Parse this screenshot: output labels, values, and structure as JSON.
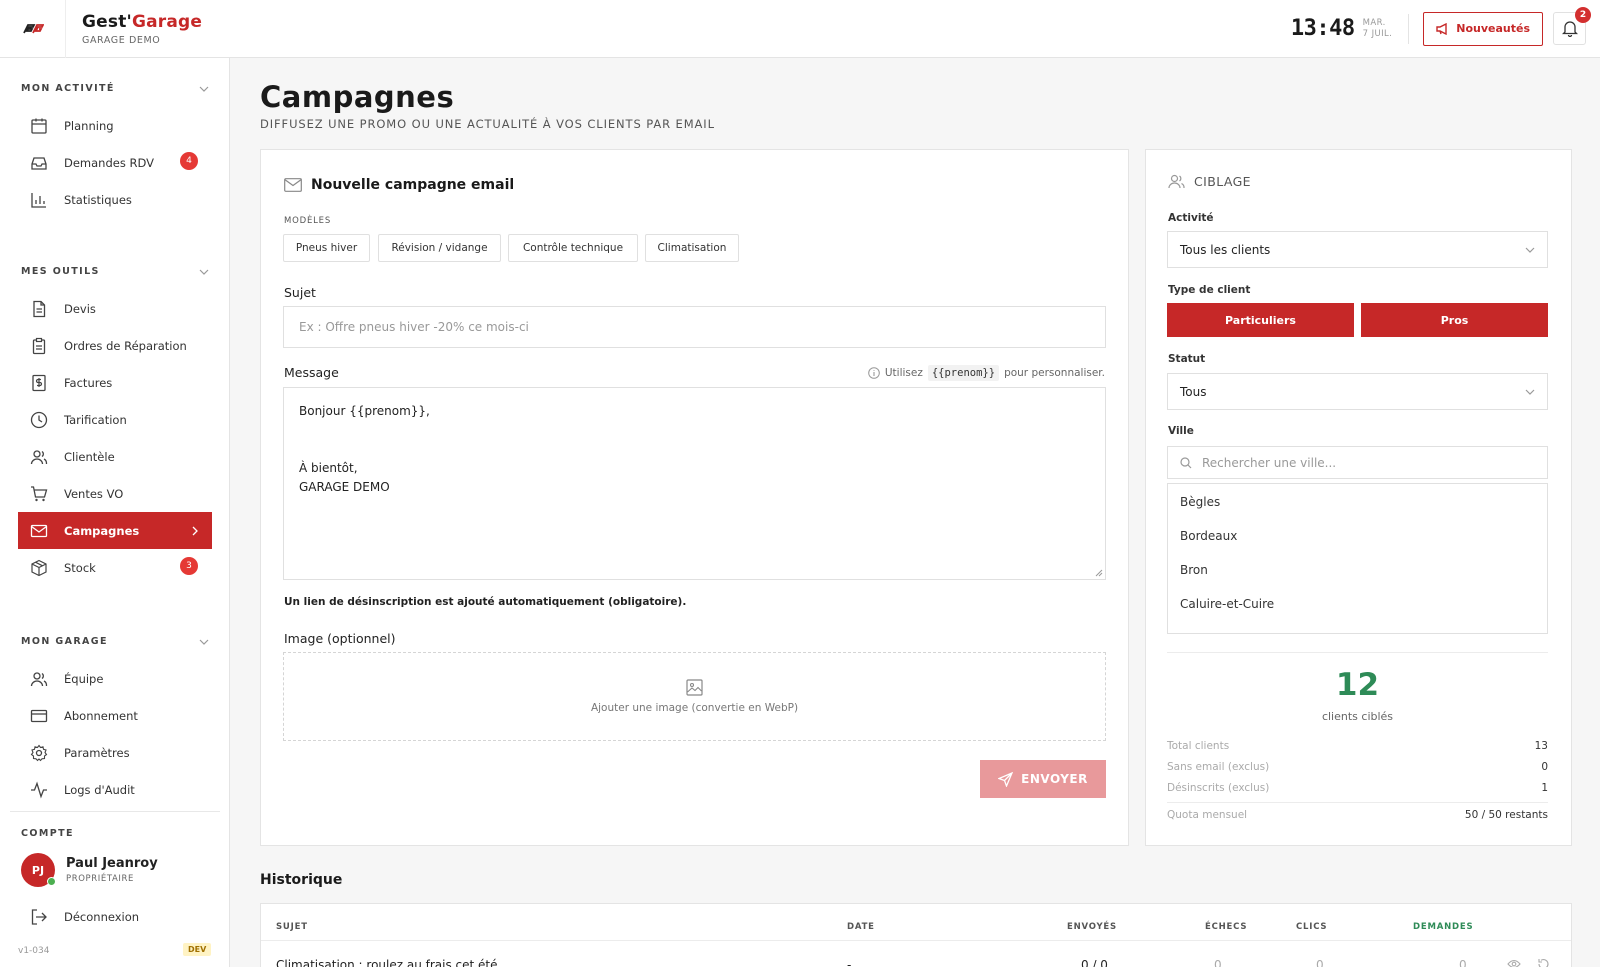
{
  "header": {
    "brand_part1": "Gest'",
    "brand_part2": "Garage",
    "garage_name": "GARAGE DEMO",
    "time": "13:48",
    "day": "MAR.",
    "date": "7 JUIL.",
    "news_label": "Nouveautés",
    "notif_count": "2",
    "brand_color": "#c62828"
  },
  "sidebar": {
    "sections": [
      {
        "title": "MON ACTIVITÉ",
        "items": [
          {
            "label": "Planning",
            "icon": "calendar-icon"
          },
          {
            "label": "Demandes RDV",
            "icon": "inbox-icon",
            "badge": "4"
          },
          {
            "label": "Statistiques",
            "icon": "bar-chart-icon"
          }
        ]
      },
      {
        "title": "MES OUTILS",
        "items": [
          {
            "label": "Devis",
            "icon": "document-icon"
          },
          {
            "label": "Ordres de Réparation",
            "icon": "clipboard-icon"
          },
          {
            "label": "Factures",
            "icon": "invoice-icon"
          },
          {
            "label": "Tarification",
            "icon": "clock-icon"
          },
          {
            "label": "Clientèle",
            "icon": "users-icon"
          },
          {
            "label": "Ventes VO",
            "icon": "cart-icon"
          },
          {
            "label": "Campagnes",
            "icon": "mail-icon",
            "active": true
          },
          {
            "label": "Stock",
            "icon": "box-icon",
            "badge": "3"
          }
        ]
      },
      {
        "title": "MON GARAGE",
        "items": [
          {
            "label": "Équipe",
            "icon": "team-icon"
          },
          {
            "label": "Abonnement",
            "icon": "credit-card-icon"
          },
          {
            "label": "Paramètres",
            "icon": "gear-icon"
          },
          {
            "label": "Logs d'Audit",
            "icon": "activity-icon"
          }
        ]
      }
    ],
    "account_title": "COMPTE",
    "user_initials": "PJ",
    "user_name": "Paul Jeanroy",
    "user_role": "PROPRIÉTAIRE",
    "logout_label": "Déconnexion",
    "version": "v1-034",
    "env_badge": "DEV"
  },
  "main": {
    "title": "Campagnes",
    "subtitle": "DIFFUSEZ UNE PROMO OU UNE ACTUALITÉ À VOS CLIENTS PAR EMAIL",
    "form": {
      "title": "Nouvelle campagne email",
      "templates_label": "MODÈLES",
      "templates": [
        "Pneus hiver",
        "Révision / vidange",
        "Contrôle technique",
        "Climatisation"
      ],
      "subject_label": "Sujet",
      "subject_placeholder": "Ex : Offre pneus hiver -20% ce mois-ci",
      "message_label": "Message",
      "hint_prefix": "Utilisez",
      "hint_code": "{{prenom}}",
      "hint_suffix": "pour personnaliser.",
      "message_lines": [
        "Bonjour {{prenom}},",
        "",
        "",
        "À bientôt,",
        "GARAGE DEMO"
      ],
      "unsubscribe_note": "Un lien de désinscription est ajouté automatiquement (obligatoire).",
      "image_label": "Image (optionnel)",
      "image_drop_text": "Ajouter une image (convertie en WebP)",
      "send_label": "ENVOYER"
    },
    "targeting": {
      "title": "CIBLAGE",
      "activity_label": "Activité",
      "activity_value": "Tous les clients",
      "client_type_label": "Type de client",
      "client_types": [
        "Particuliers",
        "Pros"
      ],
      "status_label": "Statut",
      "status_value": "Tous",
      "city_label": "Ville",
      "city_placeholder": "Rechercher une ville...",
      "cities": [
        "Bègles",
        "Bordeaux",
        "Bron",
        "Caluire-et-Cuire"
      ],
      "target_count": "12",
      "target_label": "clients ciblés",
      "stats": [
        {
          "label": "Total clients",
          "value": "13"
        },
        {
          "label": "Sans email (exclus)",
          "value": "0"
        },
        {
          "label": "Désinscrits (exclus)",
          "value": "1"
        }
      ],
      "quota_label": "Quota mensuel",
      "quota_value": "50 / 50 restants",
      "accent_color": "#2e8b57"
    },
    "history": {
      "title": "Historique",
      "columns": [
        "SUJET",
        "DATE",
        "ENVOYÉS",
        "ÉCHECS",
        "CLICS",
        "DEMANDES"
      ],
      "rows": [
        {
          "subject": "Climatisation : roulez au frais cet été",
          "date": "-",
          "sent": "0 / 0",
          "failed": "0",
          "clicks": "0",
          "requests": "0"
        }
      ]
    }
  }
}
